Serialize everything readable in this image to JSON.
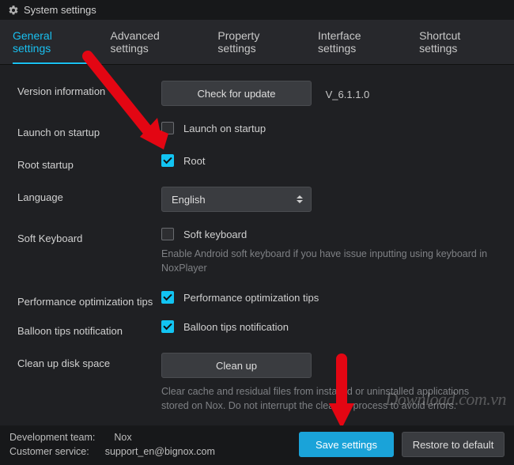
{
  "window": {
    "title": "System settings"
  },
  "tabs": [
    {
      "label": "General settings",
      "active": true
    },
    {
      "label": "Advanced settings",
      "active": false
    },
    {
      "label": "Property settings",
      "active": false
    },
    {
      "label": "Interface settings",
      "active": false
    },
    {
      "label": "Shortcut settings",
      "active": false
    }
  ],
  "rows": {
    "version": {
      "label": "Version information",
      "button": "Check for update",
      "value": "V_6.1.1.0"
    },
    "launch": {
      "label": "Launch on startup",
      "checkbox_label": "Launch on startup",
      "checked": false
    },
    "root": {
      "label": "Root startup",
      "checkbox_label": "Root",
      "checked": true
    },
    "language": {
      "label": "Language",
      "value": "English"
    },
    "softkb": {
      "label": "Soft Keyboard",
      "checkbox_label": "Soft keyboard",
      "checked": false,
      "hint": "Enable Android soft keyboard if you have issue inputting using keyboard in NoxPlayer"
    },
    "perf": {
      "label": "Performance optimization tips",
      "checkbox_label": "Performance optimization tips",
      "checked": true
    },
    "balloon": {
      "label": "Balloon tips notification",
      "checkbox_label": "Balloon tips notification",
      "checked": true
    },
    "cleanup": {
      "label": "Clean up disk space",
      "button": "Clean up",
      "hint": "Clear cache and residual files from installed or uninstalled applications stored on Nox. Do not interrupt the cleanup process to avoid errors."
    }
  },
  "footer": {
    "dev_label": "Development team:",
    "dev_value": "Nox",
    "support_label": "Customer service:",
    "support_value": "support_en@bignox.com",
    "save": "Save settings",
    "restore": "Restore to default"
  },
  "watermark": "Download.com.vn"
}
